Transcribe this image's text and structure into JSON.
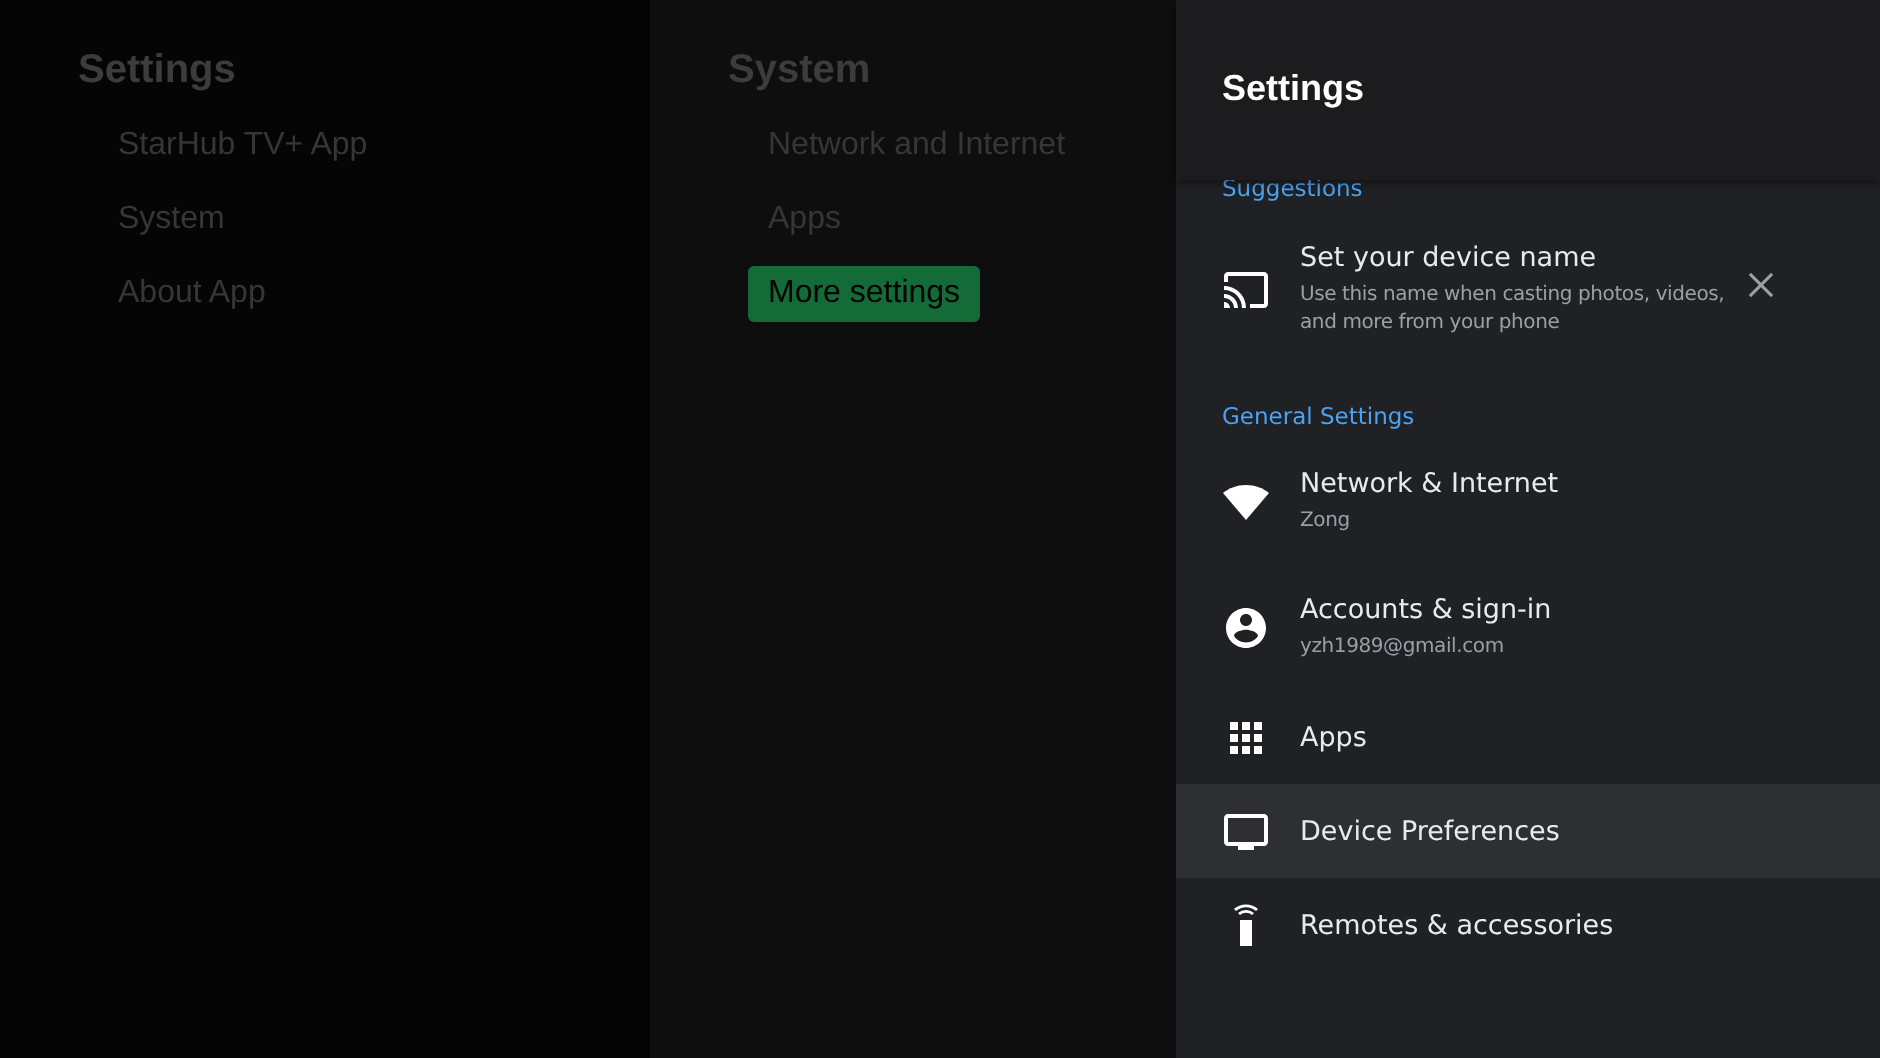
{
  "left_menu": {
    "title": "Settings",
    "items": [
      {
        "label": "StarHub TV+ App",
        "selected": false
      },
      {
        "label": "System",
        "selected": false
      },
      {
        "label": "About App",
        "selected": false
      }
    ]
  },
  "middle_menu": {
    "title": "System",
    "items": [
      {
        "label": "Network and Internet",
        "selected": false
      },
      {
        "label": "Apps",
        "selected": false
      },
      {
        "label": "More settings",
        "selected": true
      }
    ]
  },
  "panel": {
    "title": "Settings",
    "sections": [
      {
        "heading": "Suggestions",
        "items": [
          {
            "kind": "cast",
            "title": "Set your device name",
            "subtitle": "Use this name when casting photos, videos, and more from your phone",
            "dismissible": true,
            "selected": false
          }
        ]
      },
      {
        "heading": "General Settings",
        "items": [
          {
            "kind": "wifi",
            "title": "Network & Internet",
            "subtitle": "Zong",
            "selected": false
          },
          {
            "kind": "account",
            "title": "Accounts & sign-in",
            "subtitle": "yzh1989@gmail.com",
            "selected": false
          },
          {
            "kind": "apps",
            "title": "Apps",
            "selected": false
          },
          {
            "kind": "tv",
            "title": "Device Preferences",
            "selected": true
          },
          {
            "kind": "remote",
            "title": "Remotes & accessories",
            "selected": false
          }
        ]
      }
    ]
  }
}
